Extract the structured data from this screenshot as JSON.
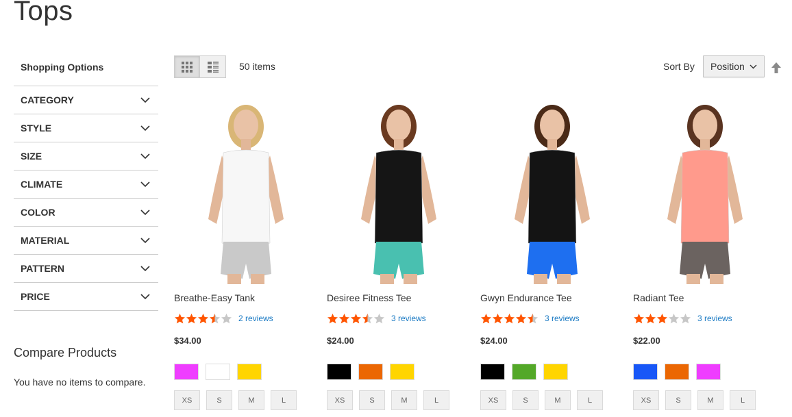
{
  "page": {
    "title": "Tops"
  },
  "sidebar": {
    "heading": "Shopping Options",
    "filters": [
      "CATEGORY",
      "STYLE",
      "SIZE",
      "CLIMATE",
      "COLOR",
      "MATERIAL",
      "PATTERN",
      "PRICE"
    ],
    "compare_title": "Compare Products",
    "compare_empty": "You have no items to compare."
  },
  "toolbar": {
    "items_count": "50 items",
    "sort_label": "Sort By",
    "sort_value": "Position",
    "view_modes": [
      "grid",
      "list"
    ],
    "active_view": "grid"
  },
  "products": [
    {
      "name": "Breathe-Easy Tank",
      "rating": 3.5,
      "reviews": "2 reviews",
      "price": "$34.00",
      "swatches": [
        "#ef3dff",
        "#ffffff",
        "#ffd500"
      ],
      "sizes": [
        "XS",
        "S",
        "M",
        "L"
      ],
      "top_color": "#f7f7f7",
      "bottom_color": "#c9c9c9",
      "hair_color": "#d9b676"
    },
    {
      "name": "Desiree Fitness Tee",
      "rating": 3.5,
      "reviews": "3 reviews",
      "price": "$24.00",
      "swatches": [
        "#000000",
        "#eb6703",
        "#ffd500"
      ],
      "sizes": [
        "XS",
        "S",
        "M",
        "L"
      ],
      "top_color": "#151515",
      "bottom_color": "#49c0b0",
      "hair_color": "#6a3a20"
    },
    {
      "name": "Gwyn Endurance Tee",
      "rating": 4.5,
      "reviews": "3 reviews",
      "price": "$24.00",
      "swatches": [
        "#000000",
        "#53a828",
        "#ffd500"
      ],
      "sizes": [
        "XS",
        "S",
        "M",
        "L"
      ],
      "top_color": "#141414",
      "bottom_color": "#1e6ff0",
      "hair_color": "#4a2a17"
    },
    {
      "name": "Radiant Tee",
      "rating": 3,
      "reviews": "3 reviews",
      "price": "$22.00",
      "swatches": [
        "#1857f7",
        "#eb6703",
        "#ef3dff"
      ],
      "sizes": [
        "XS",
        "S",
        "M",
        "L"
      ],
      "top_color": "#ff9a8c",
      "bottom_color": "#6b6360",
      "hair_color": "#5a3421"
    }
  ],
  "colors": {
    "accent": "#1979c3",
    "star": "#ff5501",
    "star_empty": "#c7c7c7"
  }
}
